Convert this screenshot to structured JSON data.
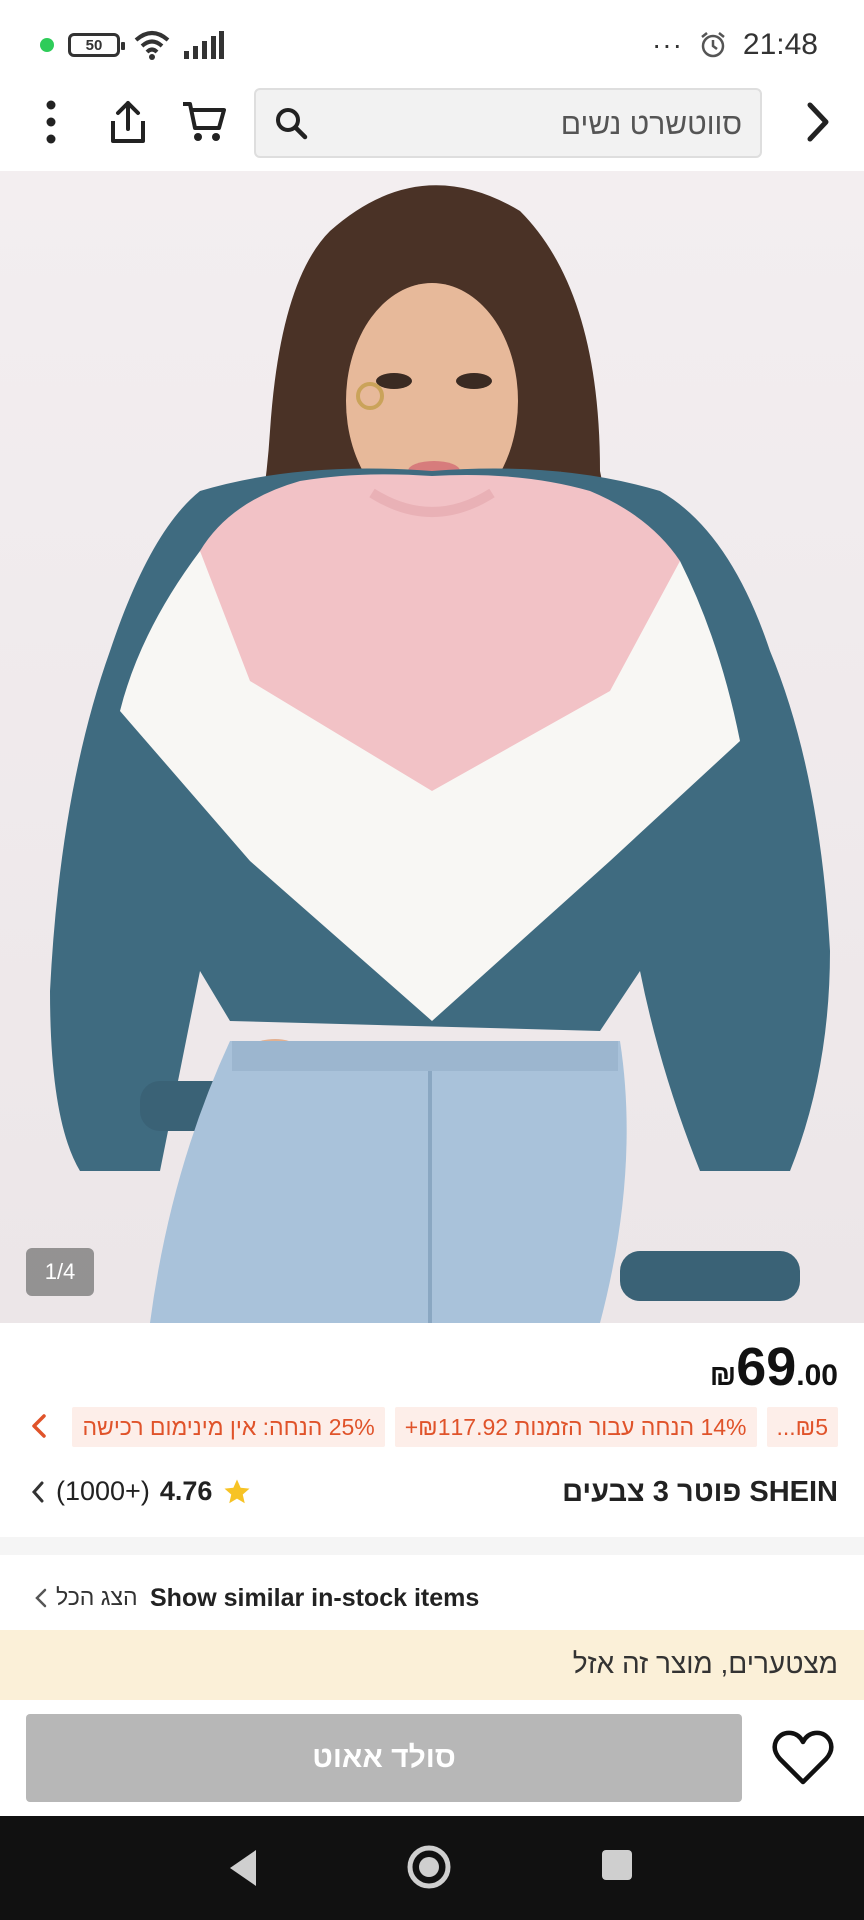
{
  "status_bar": {
    "battery": "50",
    "time": "21:48",
    "more": "···"
  },
  "header": {
    "search_text": "סווטשרט נשים"
  },
  "gallery": {
    "counter": "1/4"
  },
  "product": {
    "currency": "₪",
    "price_int": "69",
    "price_dec": ".00",
    "title": "SHEIN פוטר 3 צבעים",
    "rating": "4.76",
    "review_count": "(1000+)"
  },
  "promos": [
    "25% הנחה: אין מינימום רכישה",
    "14% הנחה עבור הזמנות ₪117.92+",
    "₪5..."
  ],
  "similar": {
    "label": "Show similar in-stock items",
    "view_all": "הצג הכל"
  },
  "soldout": {
    "banner": "מצטערים, מוצר זה אזל",
    "button": "סולד אאוט"
  },
  "colors": {
    "accent": "#e0532a",
    "promo_bg": "#fdeee9",
    "banner_bg": "#fbf0d8",
    "disabled_button": "#b7b7b7",
    "star": "#f7c325"
  },
  "icons": [
    "back-arrow-icon",
    "search-icon",
    "cart-icon",
    "share-icon",
    "more-vertical-icon",
    "star-icon",
    "heart-icon",
    "chevron-left-icon",
    "alarm-icon",
    "wifi-icon",
    "signal-icon"
  ]
}
